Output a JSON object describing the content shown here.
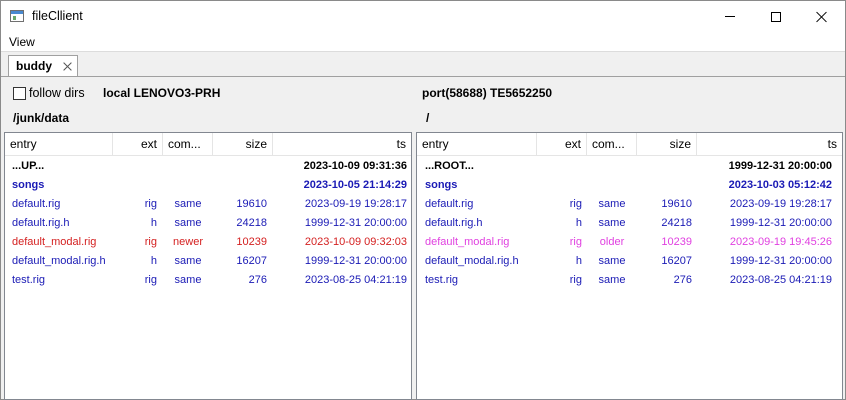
{
  "window": {
    "title": "fileCllient"
  },
  "menu": {
    "view_label": "View"
  },
  "tab": {
    "label": "buddy"
  },
  "toolbar": {
    "follow_dirs_label": "follow dirs",
    "follow_dirs_checked": false,
    "local_label": "local LENOVO3-PRH",
    "remote_label": "port(58688) TE5652250"
  },
  "paths": {
    "local": "/junk/data",
    "remote": "/"
  },
  "colors": {
    "same": "#1a1ab5",
    "newer": "#d42020",
    "older": "#e040e0",
    "dir": "#1a1ab5",
    "up": "#000000"
  },
  "columns": {
    "entry": "entry",
    "ext": "ext",
    "compare": "com...",
    "size": "size",
    "ts": "ts"
  },
  "local_rows": [
    {
      "entry": "...UP...",
      "ext": "",
      "compare": "",
      "size": "",
      "ts": "2023-10-09 09:31:36",
      "kind": "up"
    },
    {
      "entry": "songs",
      "ext": "",
      "compare": "",
      "size": "",
      "ts": "2023-10-05 21:14:29",
      "kind": "dir"
    },
    {
      "entry": "default.rig",
      "ext": "rig",
      "compare": "same",
      "size": "19610",
      "ts": "2023-09-19 19:28:17",
      "kind": "same"
    },
    {
      "entry": "default.rig.h",
      "ext": "h",
      "compare": "same",
      "size": "24218",
      "ts": "1999-12-31 20:00:00",
      "kind": "same"
    },
    {
      "entry": "default_modal.rig",
      "ext": "rig",
      "compare": "newer",
      "size": "10239",
      "ts": "2023-10-09 09:32:03",
      "kind": "newer"
    },
    {
      "entry": "default_modal.rig.h",
      "ext": "h",
      "compare": "same",
      "size": "16207",
      "ts": "1999-12-31 20:00:00",
      "kind": "same"
    },
    {
      "entry": "test.rig",
      "ext": "rig",
      "compare": "same",
      "size": "276",
      "ts": "2023-08-25 04:21:19",
      "kind": "same"
    }
  ],
  "remote_rows": [
    {
      "entry": "...ROOT...",
      "ext": "",
      "compare": "",
      "size": "",
      "ts": "1999-12-31 20:00:00",
      "kind": "up"
    },
    {
      "entry": "songs",
      "ext": "",
      "compare": "",
      "size": "",
      "ts": "2023-10-03 05:12:42",
      "kind": "dir"
    },
    {
      "entry": "default.rig",
      "ext": "rig",
      "compare": "same",
      "size": "19610",
      "ts": "2023-09-19 19:28:17",
      "kind": "same"
    },
    {
      "entry": "default.rig.h",
      "ext": "h",
      "compare": "same",
      "size": "24218",
      "ts": "1999-12-31 20:00:00",
      "kind": "same"
    },
    {
      "entry": "default_modal.rig",
      "ext": "rig",
      "compare": "older",
      "size": "10239",
      "ts": "2023-09-19 19:45:26",
      "kind": "older"
    },
    {
      "entry": "default_modal.rig.h",
      "ext": "h",
      "compare": "same",
      "size": "16207",
      "ts": "1999-12-31 20:00:00",
      "kind": "same"
    },
    {
      "entry": "test.rig",
      "ext": "rig",
      "compare": "same",
      "size": "276",
      "ts": "2023-08-25 04:21:19",
      "kind": "same"
    }
  ]
}
